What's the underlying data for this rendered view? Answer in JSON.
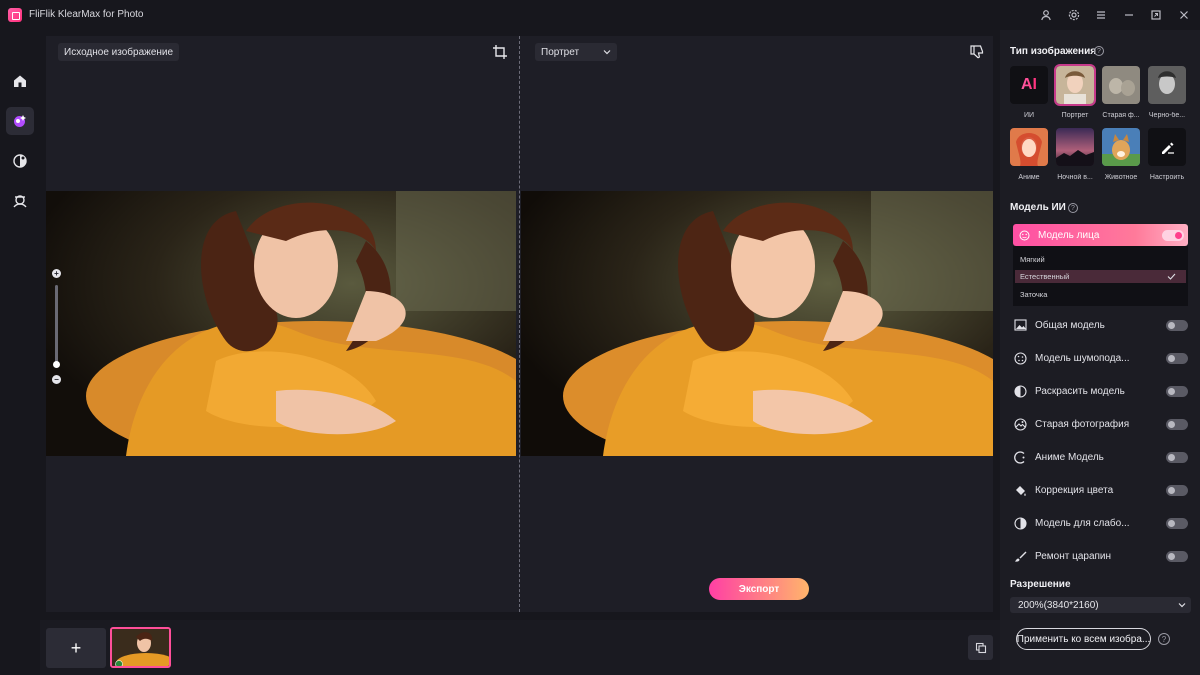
{
  "app": {
    "title": "FliFlik KlearMax for Photo"
  },
  "canvas": {
    "original_label": "Исходное изображение",
    "preset_value": "Портрет",
    "export_label": "Экспорт"
  },
  "bottom": {
    "add_label": "+"
  },
  "panel": {
    "image_type_title": "Тип изображения",
    "image_types": [
      {
        "label": "ИИ",
        "badge": "AI"
      },
      {
        "label": "Портрет"
      },
      {
        "label": "Старая ф..."
      },
      {
        "label": "Черно-бе..."
      },
      {
        "label": "Аниме"
      },
      {
        "label": "Ночной в..."
      },
      {
        "label": "Животное"
      },
      {
        "label": "Настроить"
      }
    ],
    "ai_model_title": "Модель ИИ",
    "face_model": {
      "label": "Модель лица",
      "enabled": true,
      "options": [
        "Мягкий",
        "Естественный",
        "Заточка"
      ],
      "selected": "Естественный"
    },
    "models": [
      {
        "label": "Общая модель",
        "icon": "image-icon",
        "enabled": false
      },
      {
        "label": "Модель шумопода...",
        "icon": "noise-icon",
        "enabled": false
      },
      {
        "label": "Раскрасить модель",
        "icon": "colorize-icon",
        "enabled": false
      },
      {
        "label": "Старая фотография",
        "icon": "old-photo-icon",
        "enabled": false
      },
      {
        "label": "Аниме Модель",
        "icon": "anime-icon",
        "enabled": false
      },
      {
        "label": "Коррекция цвета",
        "icon": "paint-bucket-icon",
        "enabled": false
      },
      {
        "label": "Модель для слабо...",
        "icon": "contrast-icon",
        "enabled": false
      },
      {
        "label": "Ремонт царапин",
        "icon": "brush-icon",
        "enabled": false
      }
    ],
    "resolution_title": "Разрешение",
    "resolution_value": "200%(3840*2160)",
    "apply_all_label": "Применить ко всем изобра...",
    "help_glyph": "?"
  },
  "colors": {
    "accent": "#ff3f8c",
    "export_gradient_start": "#ff3fa4",
    "export_gradient_end": "#ffb56b"
  }
}
